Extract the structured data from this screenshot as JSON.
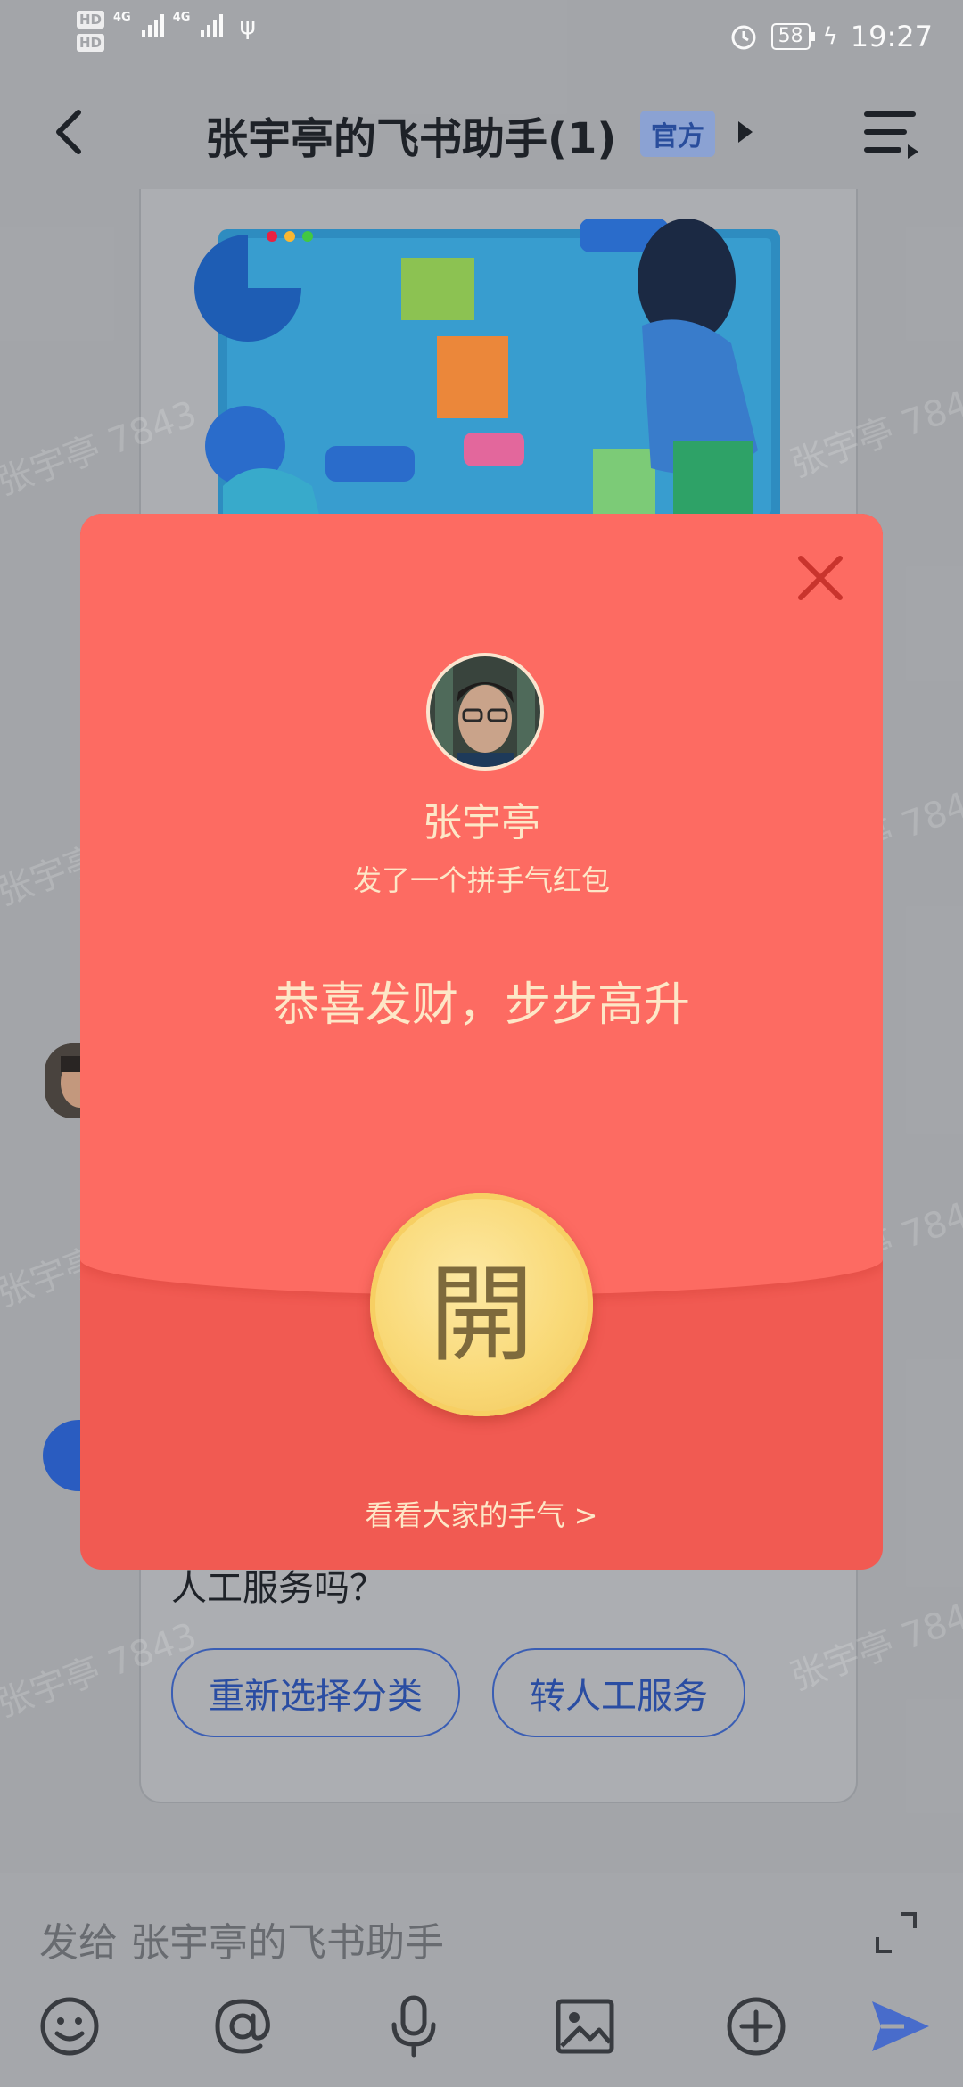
{
  "status_bar": {
    "hd1": "HD",
    "hd2": "HD",
    "net1": "4G",
    "net2": "4G",
    "battery": "58",
    "time": "19:27"
  },
  "nav": {
    "title": "张宇亭的飞书助手(1)",
    "badge": "官方"
  },
  "chat": {
    "partial_message": "人工服务吗？",
    "chips": [
      "重新选择分类",
      "转人工服务"
    ],
    "watermark": "张宇亭 7843"
  },
  "input": {
    "placeholder": "发给 张宇亭的飞书助手"
  },
  "toolbar": {
    "icons": [
      "emoji-icon",
      "mention-icon",
      "mic-icon",
      "image-icon",
      "plus-icon",
      "send-icon"
    ]
  },
  "red_packet": {
    "sender_name": "张宇亭",
    "description": "发了一个拼手气红包",
    "greeting": "恭喜发财，步步高升",
    "open_label": "開",
    "see_luck": "看看大家的手气 >"
  },
  "colors": {
    "packet_red": "#f15a52",
    "packet_top": "#fd6b62",
    "gold": "#f9d977",
    "text_cream": "#fde7c7",
    "accent_blue": "#2b4fa6"
  }
}
